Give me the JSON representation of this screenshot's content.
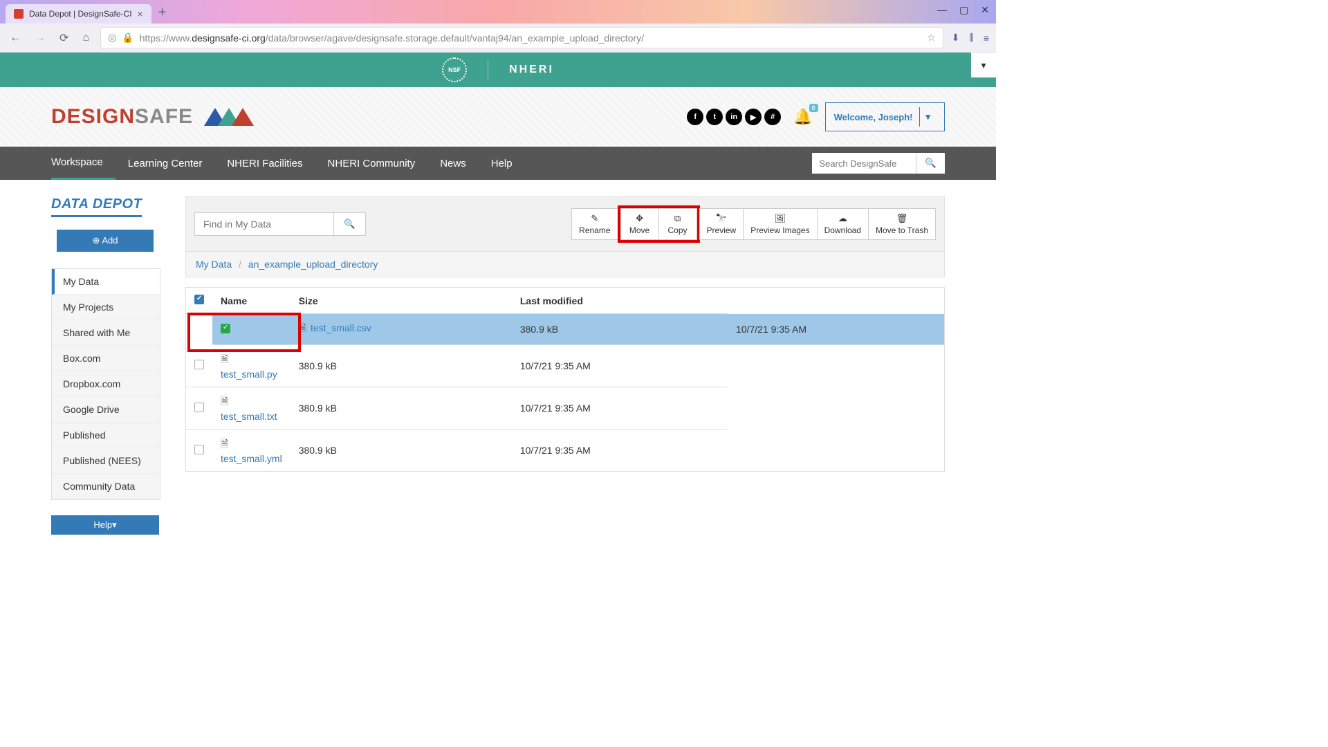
{
  "browser": {
    "tab_title": "Data Depot | DesignSafe-CI",
    "url_prefix": "https://www.",
    "url_domain": "designsafe-ci.org",
    "url_path": "/data/browser/agave/designsafe.storage.default/vantaj94/an_example_upload_directory/"
  },
  "topbar": {
    "nheri": "NHERI",
    "nsf": "NSF"
  },
  "logo": {
    "design": "DESIGN",
    "safe": "SAFE"
  },
  "header": {
    "welcome": "Welcome, Joseph!",
    "bell_badge": "8"
  },
  "nav": {
    "items": [
      "Workspace",
      "Learning Center",
      "NHERI Facilities",
      "NHERI Community",
      "News",
      "Help"
    ],
    "search_placeholder": "Search DesignSafe"
  },
  "sidebar": {
    "title": "DATA DEPOT",
    "add": "Add",
    "items": [
      "My Data",
      "My Projects",
      "Shared with Me",
      "Box.com",
      "Dropbox.com",
      "Google Drive",
      "Published",
      "Published (NEES)",
      "Community Data"
    ],
    "help": "Help"
  },
  "toolbar": {
    "find_placeholder": "Find in My Data",
    "rename": "Rename",
    "move": "Move",
    "copy": "Copy",
    "preview": "Preview",
    "preview_images": "Preview Images",
    "download": "Download",
    "trash": "Move to Trash"
  },
  "breadcrumb": {
    "root": "My Data",
    "current": "an_example_upload_directory"
  },
  "table": {
    "col_name": "Name",
    "col_size": "Size",
    "col_modified": "Last modified",
    "rows": [
      {
        "name": "test_small.csv",
        "size": "380.9 kB",
        "modified": "10/7/21 9:35 AM",
        "selected": true
      },
      {
        "name": "test_small.py",
        "size": "380.9 kB",
        "modified": "10/7/21 9:35 AM",
        "selected": false
      },
      {
        "name": "test_small.txt",
        "size": "380.9 kB",
        "modified": "10/7/21 9:35 AM",
        "selected": false
      },
      {
        "name": "test_small.yml",
        "size": "380.9 kB",
        "modified": "10/7/21 9:35 AM",
        "selected": false
      }
    ]
  }
}
